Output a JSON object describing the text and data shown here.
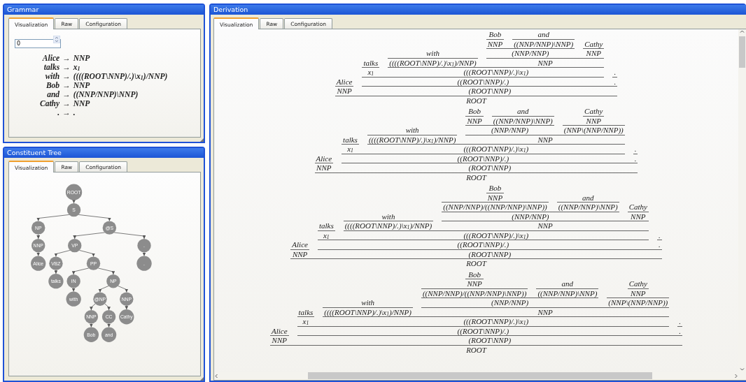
{
  "grammar_panel": {
    "title": "Grammar",
    "tabs": [
      {
        "label": "Visualization",
        "selected": true
      },
      {
        "label": "Raw",
        "selected": false
      },
      {
        "label": "Configuration",
        "selected": false
      }
    ],
    "spinner": {
      "value": "0"
    },
    "rules": [
      {
        "word": "Alice",
        "arrow": "→",
        "category": "NNP"
      },
      {
        "word": "talks",
        "arrow": "→",
        "category": "x$_{1}$"
      },
      {
        "word": "with",
        "arrow": "→",
        "category": "((((ROOT\\NNP)/.)\\x$_{1}$)/NNP)"
      },
      {
        "word": "Bob",
        "arrow": "→",
        "category": "NNP"
      },
      {
        "word": "and",
        "arrow": "→",
        "category": "((NNP/NNP)\\NNP)"
      },
      {
        "word": "Cathy",
        "arrow": "→",
        "category": "NNP"
      },
      {
        "word": ".",
        "arrow": "→",
        "category": "."
      }
    ]
  },
  "tree_panel": {
    "title": "Constituent Tree",
    "tabs": [
      {
        "label": "Visualization",
        "selected": true
      },
      {
        "label": "Raw",
        "selected": false
      },
      {
        "label": "Configuration",
        "selected": false
      }
    ],
    "tree": {
      "label": "ROOT",
      "children": [
        {
          "label": "S",
          "children": [
            {
              "label": "NP",
              "children": [
                {
                  "label": "NNP",
                  "children": [
                    {
                      "label": "Alice"
                    }
                  ]
                }
              ]
            },
            {
              "label": "@S",
              "children": [
                {
                  "label": "VP",
                  "children": [
                    {
                      "label": "VBZ",
                      "children": [
                        {
                          "label": "talks"
                        }
                      ]
                    },
                    {
                      "label": "PP",
                      "children": [
                        {
                          "label": "IN",
                          "children": [
                            {
                              "label": "with"
                            }
                          ]
                        },
                        {
                          "label": "NP",
                          "children": [
                            {
                              "label": "@NP",
                              "children": [
                                {
                                  "label": "NNP",
                                  "children": [
                                    {
                                      "label": "Bob"
                                    }
                                  ]
                                },
                                {
                                  "label": "CC",
                                  "children": [
                                    {
                                      "label": "and"
                                    }
                                  ]
                                }
                              ]
                            },
                            {
                              "label": "NNP",
                              "children": [
                                {
                                  "label": "Cathy"
                                }
                              ]
                            }
                          ]
                        }
                      ]
                    }
                  ]
                },
                {
                  "label": ".",
                  "children": [
                    {
                      "label": "."
                    }
                  ]
                }
              ]
            }
          ]
        }
      ]
    }
  },
  "derivation_panel": {
    "title": "Derivation",
    "tabs": [
      {
        "label": "Visualization",
        "selected": true
      },
      {
        "label": "Raw",
        "selected": false
      },
      {
        "label": "Configuration",
        "selected": false
      }
    ],
    "derivations": [
      {
        "category": "ROOT",
        "children": [
          {
            "word": "Alice",
            "category": "NNP"
          },
          {
            "category": "(ROOT\\NNP)",
            "children": [
              {
                "category": "((ROOT\\NNP)/.)",
                "children": [
                  {
                    "word": "talks",
                    "category": "x$_{1}$"
                  },
                  {
                    "category": "(((ROOT\\NNP)/.)\\x$_{1}$)",
                    "children": [
                      {
                        "word": "with",
                        "category": "((((ROOT\\NNP)/.)\\x$_{1}$)/NNP)"
                      },
                      {
                        "category": "NNP",
                        "children": [
                          {
                            "category": "(NNP/NNP)",
                            "children": [
                              {
                                "word": "Bob",
                                "category": "NNP"
                              },
                              {
                                "word": "and",
                                "category": "((NNP/NNP)\\NNP)"
                              }
                            ]
                          },
                          {
                            "word": "Cathy",
                            "category": "NNP"
                          }
                        ]
                      }
                    ]
                  }
                ]
              },
              {
                "word": ".",
                "category": "."
              }
            ]
          }
        ]
      },
      {
        "category": "ROOT",
        "children": [
          {
            "word": "Alice",
            "category": "NNP"
          },
          {
            "category": "(ROOT\\NNP)",
            "children": [
              {
                "category": "((ROOT\\NNP)/.)",
                "children": [
                  {
                    "word": "talks",
                    "category": "x$_{1}$"
                  },
                  {
                    "category": "(((ROOT\\NNP)/.)\\x$_{1}$)",
                    "children": [
                      {
                        "word": "with",
                        "category": "((((ROOT\\NNP)/.)\\x$_{1}$)/NNP)"
                      },
                      {
                        "category": "NNP",
                        "children": [
                          {
                            "category": "(NNP/NNP)",
                            "children": [
                              {
                                "word": "Bob",
                                "category": "NNP"
                              },
                              {
                                "word": "and",
                                "category": "((NNP/NNP)\\NNP)"
                              }
                            ]
                          },
                          {
                            "category": "(NNP\\(NNP/NNP))",
                            "children": [
                              {
                                "word": "Cathy",
                                "category": "NNP"
                              }
                            ]
                          }
                        ]
                      }
                    ]
                  }
                ]
              },
              {
                "word": ".",
                "category": "."
              }
            ]
          }
        ]
      },
      {
        "category": "ROOT",
        "children": [
          {
            "word": "Alice",
            "category": "NNP"
          },
          {
            "category": "(ROOT\\NNP)",
            "children": [
              {
                "category": "((ROOT\\NNP)/.)",
                "children": [
                  {
                    "word": "talks",
                    "category": "x$_{1}$"
                  },
                  {
                    "category": "(((ROOT\\NNP)/.)\\x$_{1}$)",
                    "children": [
                      {
                        "word": "with",
                        "category": "((((ROOT\\NNP)/.)\\x$_{1}$)/NNP)"
                      },
                      {
                        "category": "NNP",
                        "children": [
                          {
                            "category": "(NNP/NNP)",
                            "children": [
                              {
                                "category": "((NNP/NNP)/((NNP/NNP)\\NNP))",
                                "children": [
                                  {
                                    "word": "Bob",
                                    "category": "NNP"
                                  }
                                ]
                              },
                              {
                                "word": "and",
                                "category": "((NNP/NNP)\\NNP)"
                              }
                            ]
                          },
                          {
                            "word": "Cathy",
                            "category": "NNP"
                          }
                        ]
                      }
                    ]
                  }
                ]
              },
              {
                "word": ".",
                "category": "."
              }
            ]
          }
        ]
      },
      {
        "category": "ROOT",
        "children": [
          {
            "word": "Alice",
            "category": "NNP"
          },
          {
            "category": "(ROOT\\NNP)",
            "children": [
              {
                "category": "((ROOT\\NNP)/.)",
                "children": [
                  {
                    "word": "talks",
                    "category": "x$_{1}$"
                  },
                  {
                    "category": "(((ROOT\\NNP)/.)\\x$_{1}$)",
                    "children": [
                      {
                        "word": "with",
                        "category": "((((ROOT\\NNP)/.)\\x$_{1}$)/NNP)"
                      },
                      {
                        "category": "NNP",
                        "children": [
                          {
                            "category": "(NNP/NNP)",
                            "children": [
                              {
                                "category": "((NNP/NNP)/((NNP/NNP)\\NNP))",
                                "children": [
                                  {
                                    "word": "Bob",
                                    "category": "NNP"
                                  }
                                ]
                              },
                              {
                                "word": "and",
                                "category": "((NNP/NNP)\\NNP)"
                              }
                            ]
                          },
                          {
                            "category": "(NNP\\(NNP/NNP))",
                            "children": [
                              {
                                "word": "Cathy",
                                "category": "NNP"
                              }
                            ]
                          }
                        ]
                      }
                    ]
                  }
                ]
              },
              {
                "word": ".",
                "category": "."
              }
            ]
          }
        ]
      }
    ]
  }
}
